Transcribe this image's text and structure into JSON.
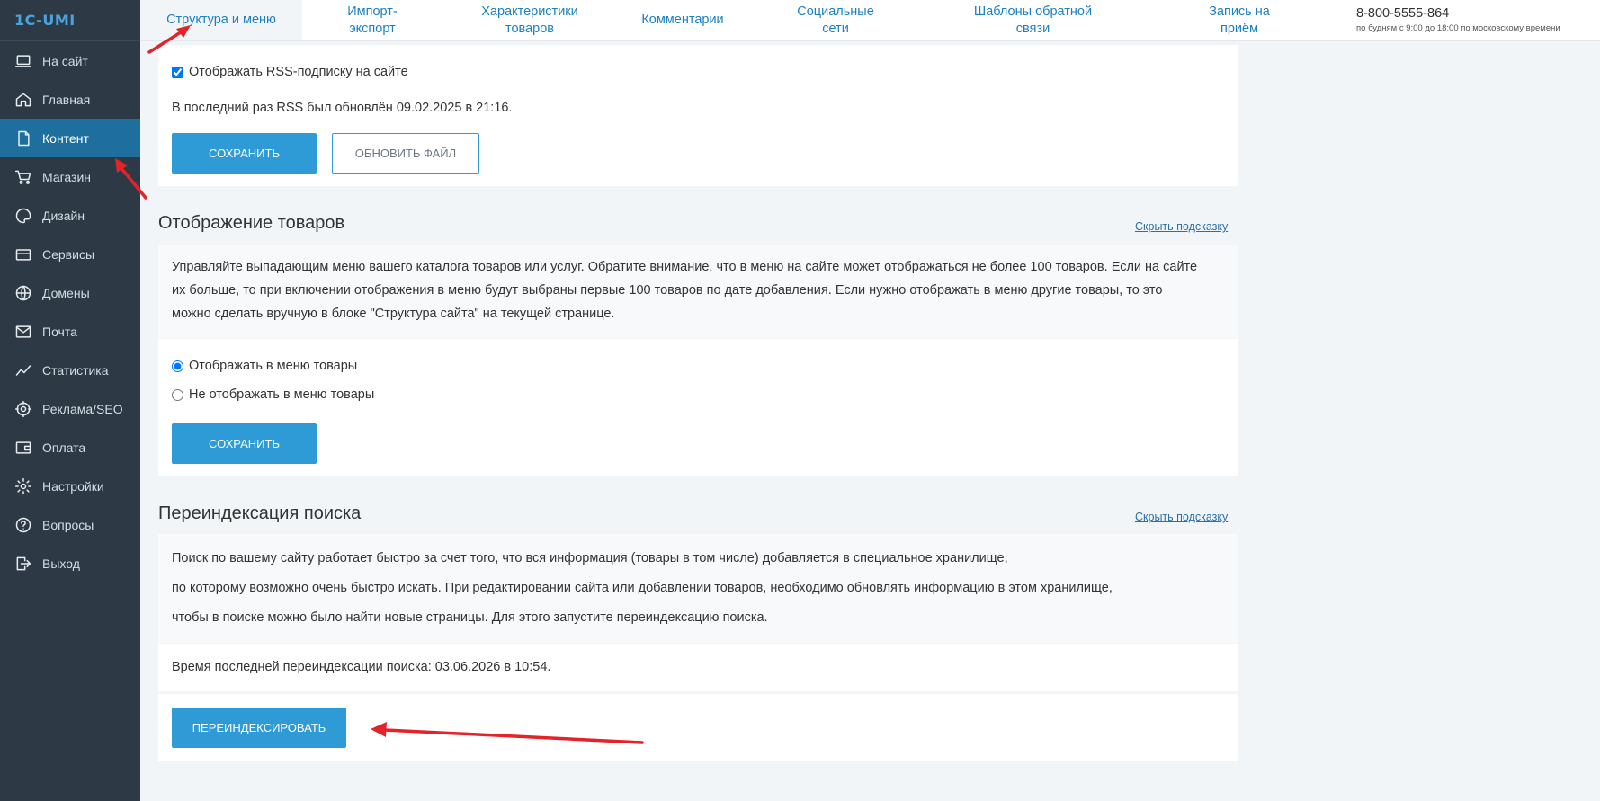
{
  "logo": {
    "text": "1C-UMI"
  },
  "sidebar": {
    "items": [
      {
        "label": "На сайт",
        "icon": "laptop-icon"
      },
      {
        "label": "Главная",
        "icon": "home-icon"
      },
      {
        "label": "Контент",
        "icon": "document-icon",
        "active": true
      },
      {
        "label": "Магазин",
        "icon": "cart-icon"
      },
      {
        "label": "Дизайн",
        "icon": "palette-icon"
      },
      {
        "label": "Сервисы",
        "icon": "services-icon"
      },
      {
        "label": "Домены",
        "icon": "globe-icon"
      },
      {
        "label": "Почта",
        "icon": "mail-icon"
      },
      {
        "label": "Статистика",
        "icon": "stats-icon"
      },
      {
        "label": "Реклама/SEO",
        "icon": "target-icon"
      },
      {
        "label": "Оплата",
        "icon": "wallet-icon"
      },
      {
        "label": "Настройки",
        "icon": "gear-icon"
      },
      {
        "label": "Вопросы",
        "icon": "question-icon"
      },
      {
        "label": "Выход",
        "icon": "logout-icon"
      }
    ]
  },
  "tabs": [
    {
      "label": "Структура и меню",
      "active": true
    },
    {
      "label": "Импорт-экспорт"
    },
    {
      "label": "Характеристики товаров"
    },
    {
      "label": "Комментарии"
    },
    {
      "label": "Социальные сети"
    },
    {
      "label": "Шаблоны обратной связи"
    },
    {
      "label": "Запись на приём"
    }
  ],
  "contact": {
    "phone": "8-800-5555-864",
    "hours": "по будням с 9:00 до 18:00 по московскому времени"
  },
  "rss": {
    "checkbox_label": "Отображать RSS-подписку на сайте",
    "checked": true,
    "last_update": "В последний раз RSS был обновлён 09.02.2025 в 21:16.",
    "save_label": "СОХРАНИТЬ",
    "refresh_label": "ОБНОВИТЬ ФАЙЛ"
  },
  "products": {
    "title": "Отображение товаров",
    "hint_link": "Скрыть подсказку",
    "description": [
      "Управляйте выпадающим меню вашего каталога товаров или услуг. Обратите внимание, что в меню на сайте может отображаться не более 100 товаров. Если на сайте",
      "их больше, то при включении отображения в меню будут выбраны первые 100 товаров по дате добавления. Если нужно отображать в меню другие товары, то это",
      "можно сделать вручную в блоке \"Структура сайта\" на текущей странице."
    ],
    "option_show": "Отображать в меню товары",
    "option_hide": "Не отображать в меню товары",
    "selected": "show",
    "save_label": "СОХРАНИТЬ"
  },
  "reindex": {
    "title": "Переиндексация поиска",
    "hint_link": "Скрыть подсказку",
    "description": [
      "Поиск по вашему сайту работает быстро за счет того, что вся информация (товары в том числе) добавляется в специальное хранилище,",
      "по которому возможно очень быстро искать. При редактировании сайта или добавлении товаров, необходимо обновлять информацию в этом хранилище,",
      "чтобы в поиске можно было найти новые страницы. Для этого запустите переиндексацию поиска."
    ],
    "last_reindex": "Время последней переиндексации поиска: 03.06.2026 в 10:54.",
    "button_label": "ПЕРЕИНДЕКСИРОВАТЬ"
  },
  "colors": {
    "sidebar_bg": "#2d3a46",
    "sidebar_active": "#1f6f9e",
    "accent": "#2e9ad6",
    "annotation_arrow": "#e3222a"
  }
}
